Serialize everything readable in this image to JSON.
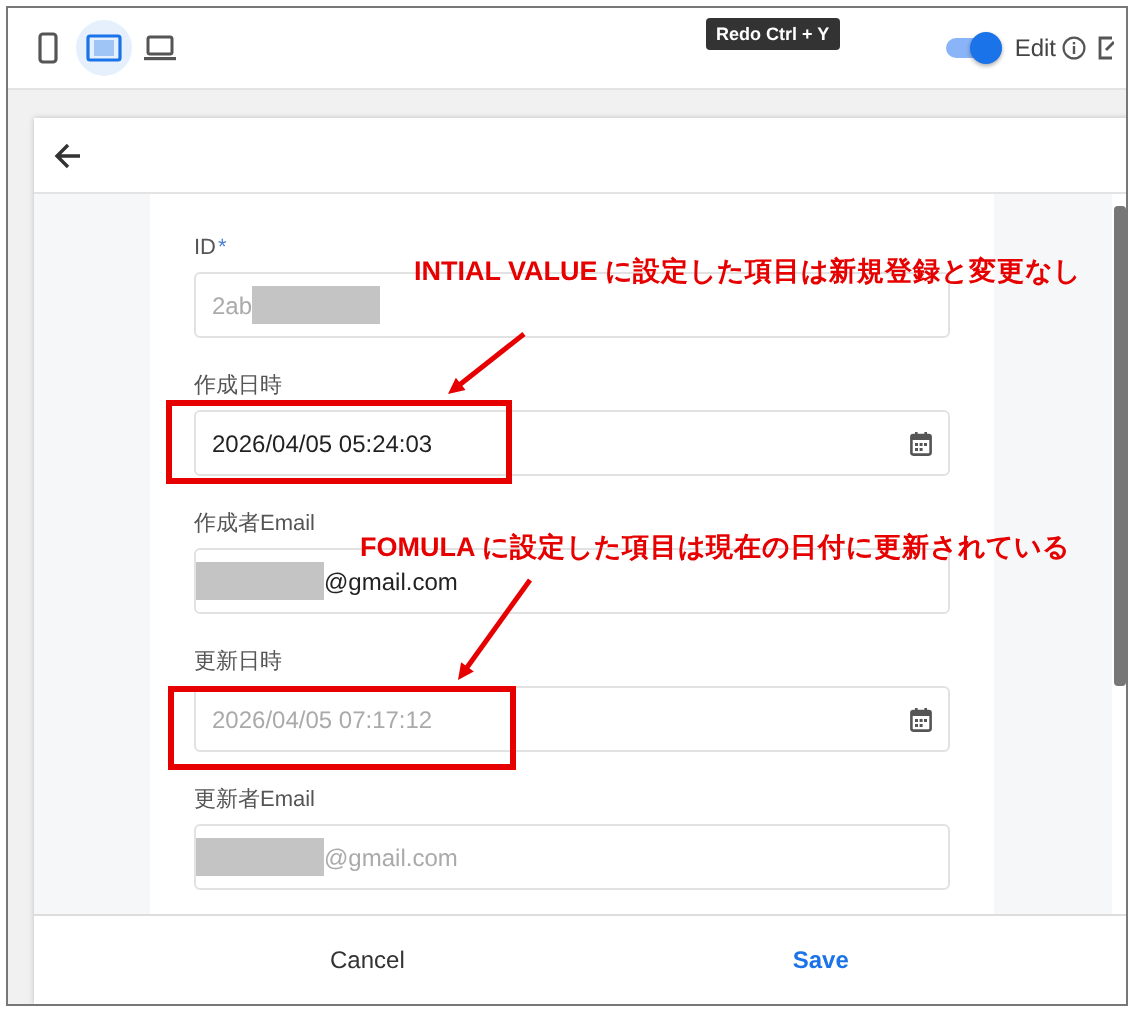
{
  "toolbar": {
    "device_buttons": [
      {
        "kind": "phone",
        "selected": false
      },
      {
        "kind": "tablet",
        "selected": true
      },
      {
        "kind": "laptop",
        "selected": false
      }
    ],
    "tooltip": "Redo Ctrl + Y",
    "edit_toggle": {
      "on": true,
      "label": "Edit"
    }
  },
  "form": {
    "fields": [
      {
        "label": "ID",
        "required_mark": "*",
        "kind": "text",
        "value_parts": [
          {
            "kind": "text",
            "text": "2ab"
          },
          {
            "kind": "redacted"
          }
        ],
        "disabled": true
      },
      {
        "label": "作成日時",
        "kind": "date",
        "value_parts": [
          {
            "kind": "text",
            "text": "2026/04/05 05:24:03"
          }
        ],
        "disabled": false
      },
      {
        "label": "作成者Email",
        "kind": "text",
        "value_parts": [
          {
            "kind": "redacted"
          },
          {
            "kind": "text",
            "text": "@gmail.com"
          }
        ],
        "disabled": false
      },
      {
        "label": "更新日時",
        "kind": "date",
        "value_parts": [
          {
            "kind": "text",
            "text": "2026/04/05 07:17:12"
          }
        ],
        "disabled": true
      },
      {
        "label": "更新者Email",
        "kind": "text",
        "value_parts": [
          {
            "kind": "redacted"
          },
          {
            "kind": "text",
            "text": "@gmail.com"
          }
        ],
        "disabled": true
      }
    ]
  },
  "footer": {
    "cancel": "Cancel",
    "save": "Save"
  },
  "annotations": [
    {
      "text": "INTIAL VALUE に設定した項目は新規登録と変更なし"
    },
    {
      "text": "FOMULA に設定した項目は現在の日付に更新されている"
    }
  ]
}
